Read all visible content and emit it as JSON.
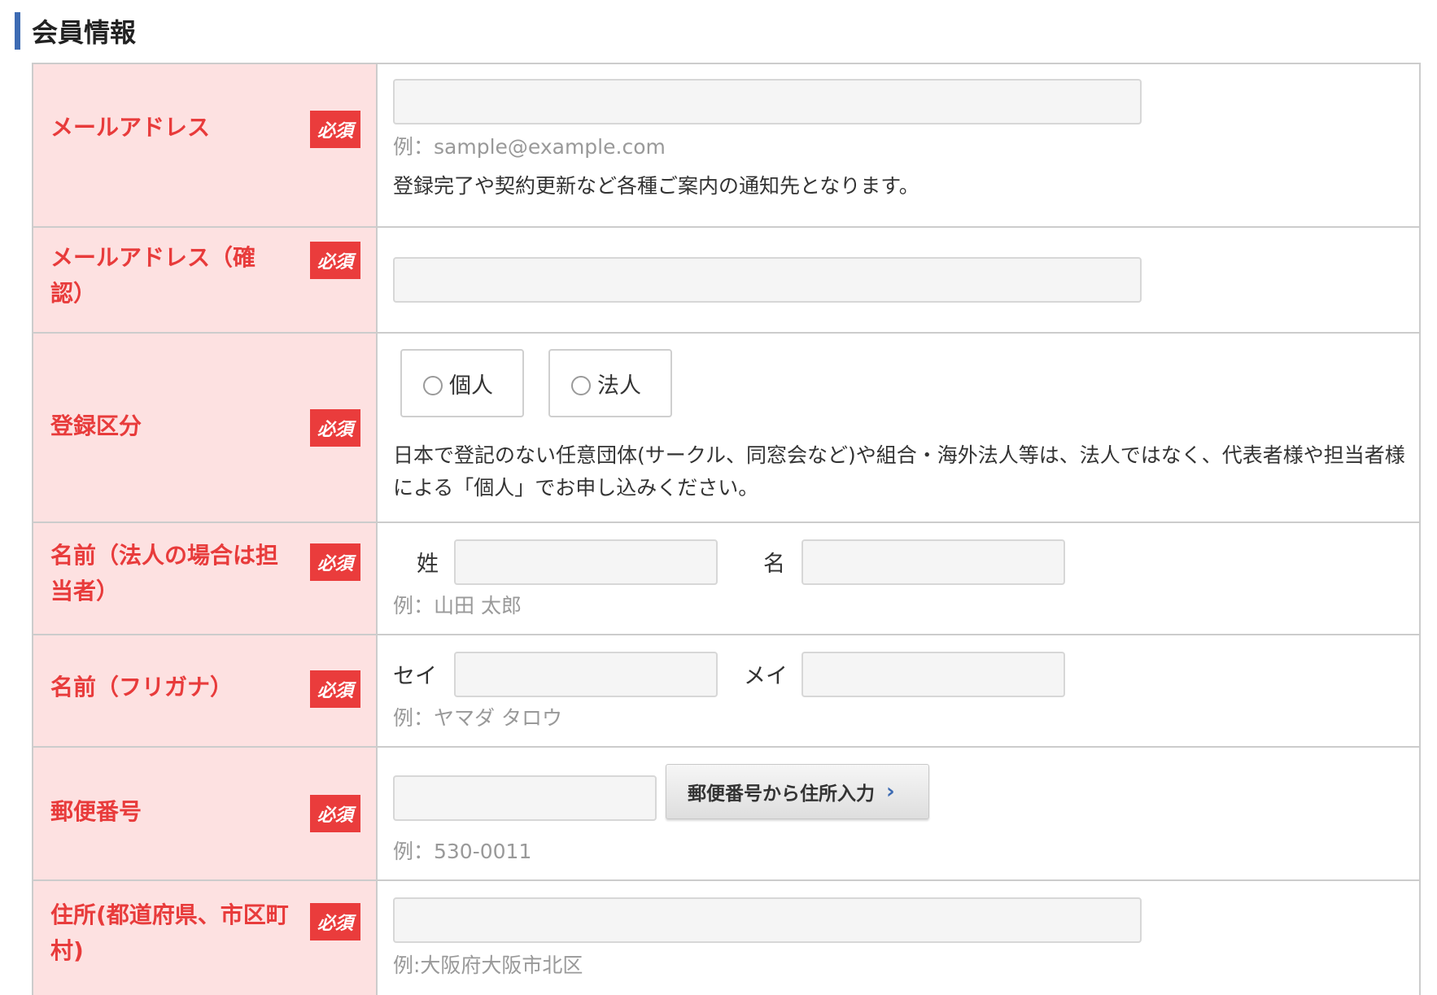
{
  "section": {
    "title": "会員情報"
  },
  "required_badge": "必須",
  "rows": {
    "email": {
      "label": "メールアドレス",
      "value": "",
      "hint": "例：sample@example.com",
      "note": "登録完了や契約更新など各種ご案内の通知先となります。"
    },
    "email_confirm": {
      "label": "メールアドレス（確認）",
      "value": ""
    },
    "registration_type": {
      "label": "登録区分",
      "options": [
        "個人",
        "法人"
      ],
      "selected": "",
      "note": "日本で登記のない任意団体(サークル、同窓会など)や組合・海外法人等は、法人ではなく、代表者様や担当者様による「個人」でお申し込みください。"
    },
    "name": {
      "label": "名前（法人の場合は担当者）",
      "last_label": "姓",
      "first_label": "名",
      "last_value": "",
      "first_value": "",
      "hint": "例：山田 太郎"
    },
    "name_kana": {
      "label": "名前（フリガナ）",
      "last_label": "セイ",
      "first_label": "メイ",
      "last_value": "",
      "first_value": "",
      "hint": "例：ヤマダ タロウ"
    },
    "zip": {
      "label": "郵便番号",
      "value": "",
      "button_label": "郵便番号から住所入力",
      "hint": "例：530-0011"
    },
    "address": {
      "label": "住所(都道府県、市区町村)",
      "value": "",
      "hint": "例:大阪府大阪市北区"
    }
  },
  "colors": {
    "accent_bar": "#3d6bb3",
    "label_bg": "#fde1e1",
    "label_text": "#e83b3b",
    "badge_bg": "#ea3c3c",
    "border": "#cccccc"
  }
}
